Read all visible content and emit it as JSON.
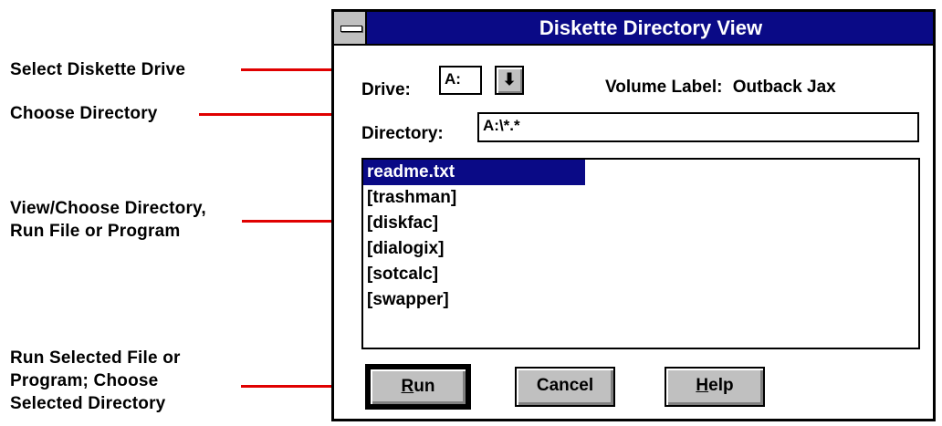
{
  "callouts": {
    "select_drive": "Select Diskette Drive",
    "choose_directory": "Choose Directory",
    "view_choose": "View/Choose Directory,\nRun File or Program",
    "run_selected": "Run Selected File or\nProgram; Choose\nSelected Directory"
  },
  "window": {
    "title": "Diskette Directory View",
    "drive_label": "Drive:",
    "drive_value": "A:",
    "dropdown_arrow": "⬇",
    "volume_label": "Volume Label:",
    "volume_value": "Outback Jax",
    "directory_label": "Directory:",
    "directory_value": "A:\\*.*",
    "files": [
      "readme.txt",
      "[trashman]",
      "[diskfac]",
      "[dialogix]",
      "[sotcalc]",
      "[swapper]"
    ],
    "buttons": {
      "run_first": "R",
      "run_rest": "un",
      "cancel": "Cancel",
      "help_first": "H",
      "help_rest": "elp"
    }
  },
  "colors": {
    "titlebar": "#0a0a86",
    "callout_line": "#e00000",
    "button_face": "#c0c0c0"
  }
}
